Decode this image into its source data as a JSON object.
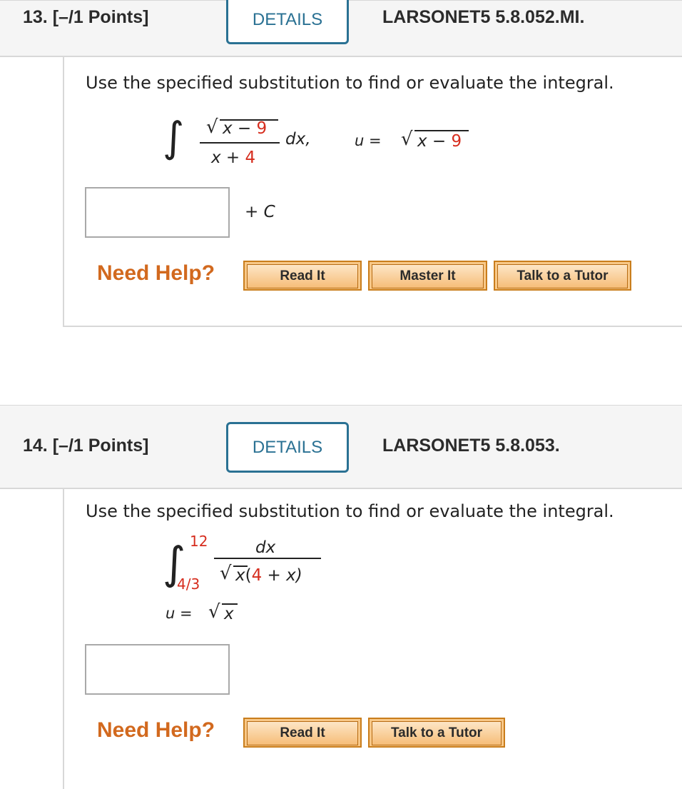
{
  "q13": {
    "number": "13.",
    "points": "[–/1 Points]",
    "details_label": "DETAILS",
    "reference": "LARSONET5 5.8.052.MI.",
    "prompt": "Use the specified substitution to find or evaluate the integral.",
    "integral": {
      "integral_sign": "∫",
      "numerator_radicand": "x − ",
      "numerator_number": "9",
      "denominator_var": "x + ",
      "denominator_number": "4",
      "differential": "dx,",
      "substitution_lhs": "u = ",
      "substitution_radicand": "x − ",
      "substitution_number": "9"
    },
    "answer_value": "",
    "plus_c": "+ C",
    "need_help": "Need Help?",
    "buttons": [
      "Read It",
      "Master It",
      "Talk to a Tutor"
    ]
  },
  "q14": {
    "number": "14.",
    "points": "[–/1 Points]",
    "details_label": "DETAILS",
    "reference": "LARSONET5 5.8.053.",
    "prompt": "Use the specified substitution to find or evaluate the integral.",
    "integral": {
      "integral_sign": "∫",
      "upper_limit": "12",
      "lower_limit": "4/3",
      "numerator": "dx",
      "denominator_radicand": "x",
      "denominator_open": "(",
      "denominator_number": "4",
      "denominator_rest": " + x)",
      "substitution_lhs": "u = ",
      "substitution_radicand": "x"
    },
    "answer_value": "",
    "need_help": "Need Help?",
    "buttons": [
      "Read It",
      "Talk to a Tutor"
    ]
  },
  "colors": {
    "accent": "#2a7193",
    "need_help": "#d2691e",
    "math_number": "#d62d1e",
    "button_fill": "#f8c888"
  }
}
